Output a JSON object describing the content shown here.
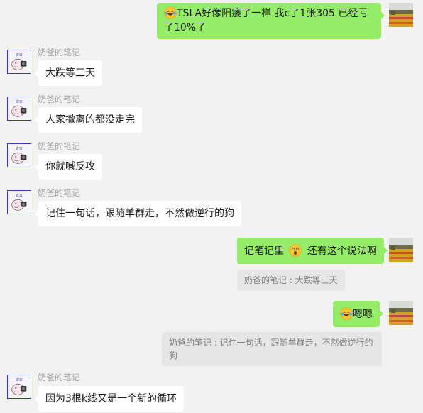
{
  "contact": {
    "name": "奶爸的笔记",
    "avatar_icon": "cartoon-character-avatar-icon"
  },
  "self": {
    "avatar_icon": "tulip-field-avatar-icon"
  },
  "messages": [
    {
      "side": "out",
      "emoji": "laughing-tears-emoji",
      "text": "TSLA好像阳痿了一样 我c了1张305 已经亏了10%了"
    },
    {
      "side": "in",
      "sender": "奶爸的笔记",
      "text": "大跌等三天"
    },
    {
      "side": "in",
      "sender": "奶爸的笔记",
      "text": "人家撤离的都没走完"
    },
    {
      "side": "in",
      "sender": "奶爸的笔记",
      "text": "你就喊反攻"
    },
    {
      "side": "in",
      "sender": "奶爸的笔记",
      "text": "记住一句话，跟随羊群走，不然做逆行的狗"
    },
    {
      "side": "out",
      "text_before": "记笔记里",
      "emoji": "wow-emoji",
      "text_after": "还有这个说法啊",
      "quote": "奶爸的笔记 : 大跌等三天"
    },
    {
      "side": "out",
      "emoji": "laughing-tears-emoji",
      "text": "嗯嗯",
      "quote": "奶爸的笔记 : 记住一句话，跟随羊群走，不然做逆行的狗"
    },
    {
      "side": "in",
      "sender": "奶爸的笔记",
      "text": "因为3根k线又是一个新的循环"
    }
  ],
  "colors": {
    "background": "#f2f2f2",
    "bubble_out": "#95ec69",
    "bubble_in": "#ffffff",
    "quote_bg": "#e6e6e6",
    "name_text": "#a6a6a6"
  }
}
